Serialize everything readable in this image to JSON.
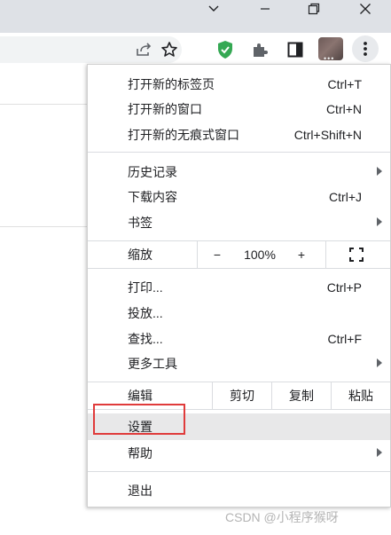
{
  "icons": {
    "window": [
      "chevron-down-icon",
      "minimize-icon",
      "restore-icon",
      "close-icon"
    ],
    "toolbar": [
      "share-icon",
      "bookmark-star-icon",
      "shield-extension-icon",
      "puzzle-extensions-icon",
      "side-panel-icon",
      "avatar",
      "kebab-menu-icon"
    ],
    "menu": [
      "fullscreen-icon",
      "submenu-arrow-icon"
    ]
  },
  "colors": {
    "shield": "#34a853",
    "highlight": "#e8e8e9",
    "annotation_box": "#e03b3b"
  },
  "menu": {
    "new_tab": {
      "label": "打开新的标签页",
      "shortcut": "Ctrl+T"
    },
    "new_window": {
      "label": "打开新的窗口",
      "shortcut": "Ctrl+N"
    },
    "new_incognito": {
      "label": "打开新的无痕式窗口",
      "shortcut": "Ctrl+Shift+N"
    },
    "history": {
      "label": "历史记录"
    },
    "downloads": {
      "label": "下载内容",
      "shortcut": "Ctrl+J"
    },
    "bookmarks": {
      "label": "书签"
    },
    "zoom": {
      "label": "缩放",
      "minus": "−",
      "value": "100%",
      "plus": "+"
    },
    "print": {
      "label": "打印...",
      "shortcut": "Ctrl+P"
    },
    "cast": {
      "label": "投放..."
    },
    "find": {
      "label": "查找...",
      "shortcut": "Ctrl+F"
    },
    "more_tools": {
      "label": "更多工具"
    },
    "edit": {
      "label": "编辑",
      "cut": "剪切",
      "copy": "复制",
      "paste": "粘贴"
    },
    "settings": {
      "label": "设置",
      "highlighted": true
    },
    "help": {
      "label": "帮助"
    },
    "exit": {
      "label": "退出"
    }
  },
  "watermark": "CSDN @小程序猴呀"
}
